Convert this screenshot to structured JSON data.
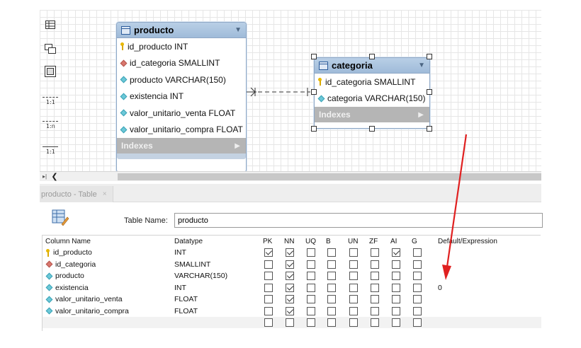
{
  "diagram": {
    "tables": {
      "producto": {
        "name": "producto",
        "fields": [
          {
            "label": "id_producto INT",
            "icon": "key-icon"
          },
          {
            "label": "id_categoria SMALLINT",
            "icon": "fk-diamond-icon"
          },
          {
            "label": "producto VARCHAR(150)",
            "icon": "column-diamond-icon"
          },
          {
            "label": "existencia INT",
            "icon": "column-diamond-icon"
          },
          {
            "label": "valor_unitario_venta FLOAT",
            "icon": "column-diamond-icon"
          },
          {
            "label": "valor_unitario_compra FLOAT",
            "icon": "column-diamond-icon"
          }
        ],
        "indexes_label": "Indexes"
      },
      "categoria": {
        "name": "categoria",
        "fields": [
          {
            "label": "id_categoria SMALLINT",
            "icon": "key-icon"
          },
          {
            "label": "categoria VARCHAR(150)",
            "icon": "column-diamond-icon"
          }
        ],
        "indexes_label": "Indexes"
      }
    },
    "tools": {
      "rel_1_1": "1:1",
      "rel_1_n": "1:n",
      "rel_1_1_b": "1:1"
    }
  },
  "tab": {
    "label": "producto - Table",
    "close": "×"
  },
  "editor": {
    "table_name_label": "Table Name:",
    "table_name_value": "producto",
    "columns": [
      "Column Name",
      "Datatype",
      "PK",
      "NN",
      "UQ",
      "B",
      "UN",
      "ZF",
      "AI",
      "G",
      "Default/Expression"
    ],
    "rows": [
      {
        "name": "id_producto",
        "type": "INT",
        "icon": "key-icon",
        "pk": true,
        "nn": true,
        "uq": false,
        "b": false,
        "un": false,
        "zf": false,
        "ai": true,
        "g": false,
        "default": ""
      },
      {
        "name": "id_categoria",
        "type": "SMALLINT",
        "icon": "fk-diamond-icon",
        "pk": false,
        "nn": true,
        "uq": false,
        "b": false,
        "un": false,
        "zf": false,
        "ai": false,
        "g": false,
        "default": ""
      },
      {
        "name": "producto",
        "type": "VARCHAR(150)",
        "icon": "column-diamond-icon",
        "pk": false,
        "nn": true,
        "uq": false,
        "b": false,
        "un": false,
        "zf": false,
        "ai": false,
        "g": false,
        "default": ""
      },
      {
        "name": "existencia",
        "type": "INT",
        "icon": "column-diamond-icon",
        "pk": false,
        "nn": true,
        "uq": false,
        "b": false,
        "un": false,
        "zf": false,
        "ai": false,
        "g": false,
        "default": "0"
      },
      {
        "name": "valor_unitario_venta",
        "type": "FLOAT",
        "icon": "column-diamond-icon",
        "pk": false,
        "nn": true,
        "uq": false,
        "b": false,
        "un": false,
        "zf": false,
        "ai": false,
        "g": false,
        "default": ""
      },
      {
        "name": "valor_unitario_compra",
        "type": "FLOAT",
        "icon": "column-diamond-icon",
        "pk": false,
        "nn": true,
        "uq": false,
        "b": false,
        "un": false,
        "zf": false,
        "ai": false,
        "g": false,
        "default": ""
      },
      {
        "name": "",
        "type": "",
        "icon": "",
        "pk": false,
        "nn": false,
        "uq": false,
        "b": false,
        "un": false,
        "zf": false,
        "ai": false,
        "g": false,
        "default": ""
      }
    ]
  },
  "colors": {
    "entity_header": "#a9c4e0",
    "annotation_arrow": "#e02020",
    "key": "#e8b800",
    "fk": "#d9776e",
    "column": "#6cc8d8"
  }
}
